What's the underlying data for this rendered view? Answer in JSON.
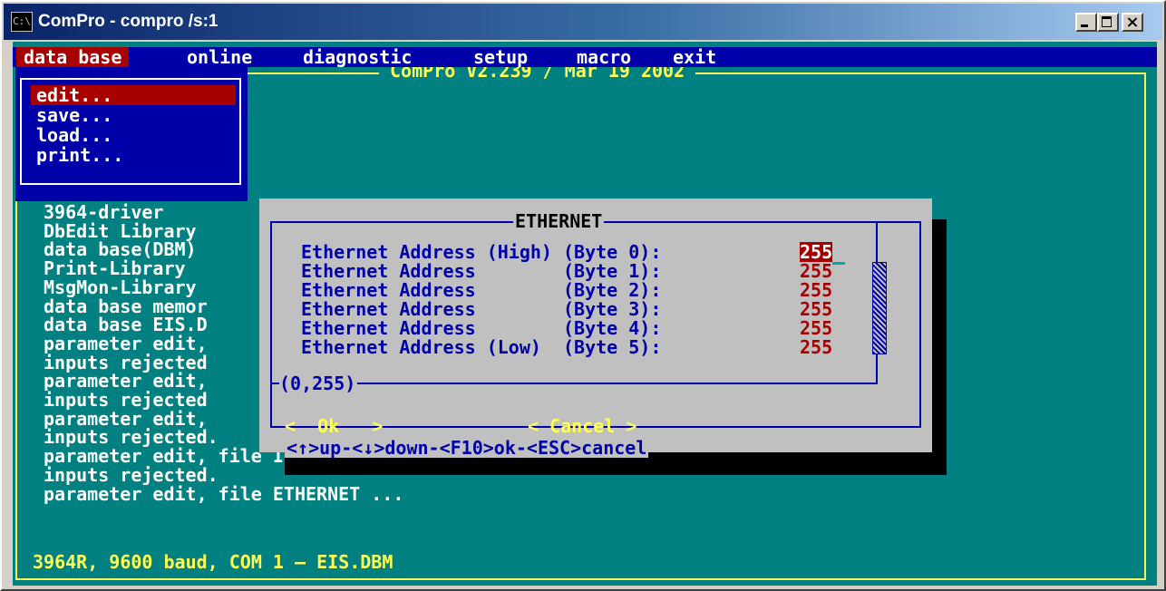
{
  "window": {
    "title": "ComPro - compro /s:1",
    "icon": "console-app-icon"
  },
  "menubar": {
    "items": [
      "data base",
      "online",
      "diagnostic",
      "setup",
      "macro",
      "exit"
    ],
    "active": "data base"
  },
  "banner": "ComPro V2.239 / Mar 19 2002",
  "dropdown": {
    "items": [
      "edit...",
      "save...",
      "load...",
      "print..."
    ],
    "selected": "edit..."
  },
  "log": [
    "3964-driver",
    "DbEdit Library",
    "data base(DBM)",
    "Print-Library",
    "MsgMon-Library",
    "data base memor",
    "data base EIS.D",
    "parameter edit,",
    "inputs rejected",
    "parameter edit,",
    "inputs rejected",
    "parameter edit,",
    "inputs rejected.",
    "parameter edit, file IP_SETUP ...",
    "inputs rejected.",
    "parameter edit, file ETHERNET ..."
  ],
  "dialog": {
    "title": "ETHERNET",
    "fields": [
      {
        "label": "Ethernet Address (High) (Byte 0):",
        "value": "255"
      },
      {
        "label": "Ethernet Address        (Byte 1):",
        "value": "255"
      },
      {
        "label": "Ethernet Address        (Byte 2):",
        "value": "255"
      },
      {
        "label": "Ethernet Address        (Byte 3):",
        "value": "255"
      },
      {
        "label": "Ethernet Address        (Byte 4):",
        "value": "255"
      },
      {
        "label": "Ethernet Address (Low)  (Byte 5):",
        "value": "255"
      }
    ],
    "range": "(0,255)",
    "ok_label": "<  Ok   >",
    "cancel_label": "< Cancel >",
    "hint": "<↑>up-<↓>down-<F10>ok-<ESC>cancel"
  },
  "status": "3964R, 9600 baud, COM 1 — EIS.DBM",
  "colors": {
    "console_bg": "#008080",
    "menu_bg": "#0000a8",
    "highlight": "#a80000",
    "frame_yellow": "#ffff55",
    "dialog_bg": "#c0c0c0"
  }
}
